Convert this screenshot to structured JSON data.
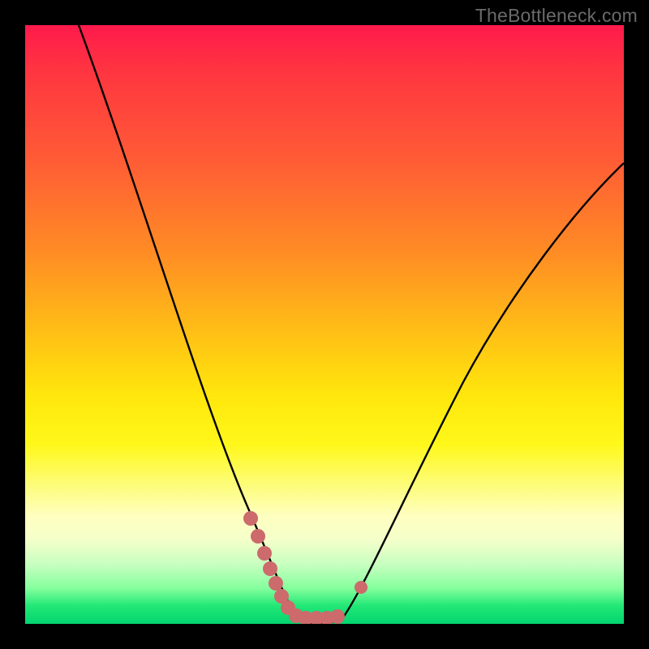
{
  "watermark": "TheBottleneck.com",
  "chart_data": {
    "type": "line",
    "title": "",
    "xlabel": "",
    "ylabel": "",
    "xlim": [
      0,
      100
    ],
    "ylim": [
      0,
      100
    ],
    "grid": false,
    "series": [
      {
        "name": "bottleneck-curve",
        "color": "#000000",
        "x": [
          9,
          12,
          15,
          18,
          21,
          24,
          27,
          30,
          33,
          35,
          37,
          39,
          41,
          43,
          45,
          47,
          49,
          51,
          53,
          56,
          60,
          64,
          68,
          72,
          76,
          80,
          84,
          88,
          92,
          96,
          100
        ],
        "values": [
          100,
          91,
          81,
          72,
          63,
          54,
          46,
          38,
          30,
          24,
          19,
          14,
          10,
          6,
          3,
          1,
          0,
          0,
          1,
          3,
          8,
          14,
          22,
          30,
          38,
          46,
          54,
          61,
          68,
          74,
          80
        ]
      }
    ],
    "markers": {
      "name": "highlight-dots",
      "color": "#cc6a6c",
      "points": [
        {
          "x": 37,
          "y": 18
        },
        {
          "x": 39,
          "y": 13
        },
        {
          "x": 40,
          "y": 9
        },
        {
          "x": 41,
          "y": 6
        },
        {
          "x": 43,
          "y": 3
        },
        {
          "x": 45,
          "y": 1
        },
        {
          "x": 47,
          "y": 0
        },
        {
          "x": 49,
          "y": 0
        },
        {
          "x": 51,
          "y": 0
        },
        {
          "x": 53,
          "y": 1
        },
        {
          "x": 56,
          "y": 4
        }
      ]
    }
  }
}
